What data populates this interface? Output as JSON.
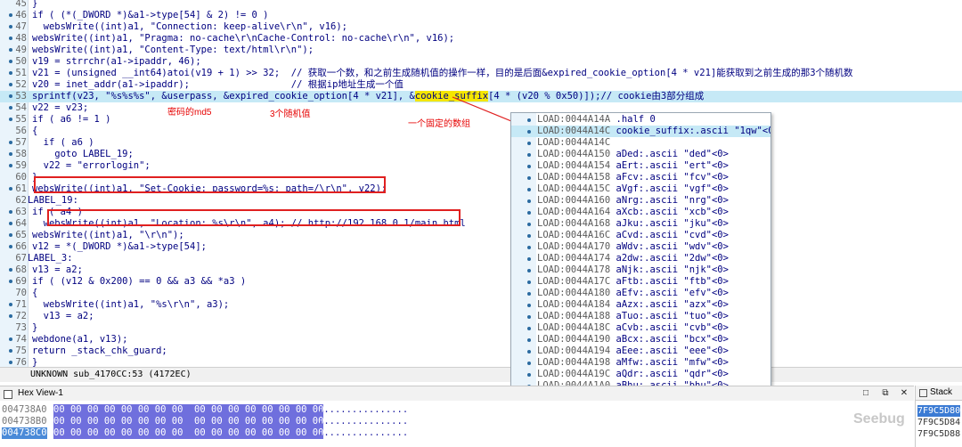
{
  "code_lines": [
    {
      "ln": "45",
      "text": "}",
      "dot": false
    },
    {
      "ln": "46",
      "text": "if ( (*(_DWORD *)&a1->type[54] & 2) != 0 )",
      "dot": true
    },
    {
      "ln": "47",
      "text": "  websWrite((int)a1, \"Connection: keep-alive\\r\\n\", v16);",
      "dot": true
    },
    {
      "ln": "48",
      "text": "websWrite((int)a1, \"Pragma: no-cache\\r\\nCache-Control: no-cache\\r\\n\", v16);",
      "dot": true
    },
    {
      "ln": "49",
      "text": "websWrite((int)a1, \"Content-Type: text/html\\r\\n\");",
      "dot": true
    },
    {
      "ln": "50",
      "text": "v19 = strrchr(a1->ipaddr, 46);",
      "dot": true
    },
    {
      "ln": "51",
      "text": "v21 = (unsigned __int64)atoi(v19 + 1) >> 32;  // 获取一个数，和之前生成随机值的操作一样，目的是后面&expired_cookie_option[4 * v21]能获取到之前生成的那3个随机数",
      "dot": true
    },
    {
      "ln": "52",
      "text": "v20 = inet_addr(a1->ipaddr);                  // 根据ip地址生成一个值",
      "dot": true
    },
    {
      "ln": "53",
      "text": "",
      "dot": true,
      "special": "sprintf"
    },
    {
      "ln": "54",
      "text": "v22 = v23;",
      "dot": true
    },
    {
      "ln": "55",
      "text": "if ( a6 != 1 )",
      "dot": true
    },
    {
      "ln": "56",
      "text": "{",
      "dot": false
    },
    {
      "ln": "57",
      "text": "  if ( a6 )",
      "dot": true
    },
    {
      "ln": "58",
      "text": "    goto LABEL_19;",
      "dot": true
    },
    {
      "ln": "59",
      "text": "  v22 = \"errorlogin\";",
      "dot": true
    },
    {
      "ln": "60",
      "text": "}",
      "dot": false
    },
    {
      "ln": "61",
      "text": "websWrite((int)a1, \"Set-Cookie: password=%s; path=/\\r\\n\", v22);",
      "dot": true
    },
    {
      "ln": "62",
      "text": "LABEL_19:",
      "dot": false,
      "label": true
    },
    {
      "ln": "63",
      "text": "if ( a4 )",
      "dot": true
    },
    {
      "ln": "64",
      "text": "  websWrite((int)a1, \"Location: %s\\r\\n\", a4); // http://192.168.0.1/main.html",
      "dot": true
    },
    {
      "ln": "65",
      "text": "websWrite((int)a1, \"\\r\\n\");",
      "dot": true
    },
    {
      "ln": "66",
      "text": "v12 = *(_DWORD *)&a1->type[54];",
      "dot": true
    },
    {
      "ln": "67",
      "text": "LABEL_3:",
      "dot": false,
      "label": true
    },
    {
      "ln": "68",
      "text": "v13 = a2;",
      "dot": true
    },
    {
      "ln": "69",
      "text": "if ( (v12 & 0x200) == 0 && a3 && *a3 )",
      "dot": true
    },
    {
      "ln": "70",
      "text": "{",
      "dot": false
    },
    {
      "ln": "71",
      "text": "  websWrite((int)a1, \"%s\\r\\n\", a3);",
      "dot": true
    },
    {
      "ln": "72",
      "text": "  v13 = a2;",
      "dot": true
    },
    {
      "ln": "73",
      "text": "}",
      "dot": false
    },
    {
      "ln": "74",
      "text": "webdone(a1, v13);",
      "dot": true
    },
    {
      "ln": "75",
      "text": "return _stack_chk_guard;",
      "dot": true
    },
    {
      "ln": "76",
      "text": "}",
      "dot": true
    }
  ],
  "sprintf_line": {
    "before": "sprintf(v23, \"%s%s%s\", &userpass, &expired_cookie_option[4 * v21], &",
    "highlight": "cookie_suffix",
    "after": "[4 * (v20 % 0x50)]);// cookie由3部分组成"
  },
  "annotations": {
    "md5": "密码的md5",
    "random3": "3个随机值",
    "fixed_array": "一个固定的数组"
  },
  "status_text": "UNKNOWN sub_4170CC:53 (4172EC)",
  "popup_lines": [
    {
      "addr": "LOAD:0044A14A",
      "text": ".half 0"
    },
    {
      "addr": "LOAD:0044A14C",
      "text": "cookie_suffix:.ascii \"1qw\"<0>",
      "selected": true
    },
    {
      "addr": "LOAD:0044A14C",
      "text": ""
    },
    {
      "addr": "LOAD:0044A150",
      "text": "aDed:.ascii \"ded\"<0>"
    },
    {
      "addr": "LOAD:0044A154",
      "text": "aErt:.ascii \"ert\"<0>"
    },
    {
      "addr": "LOAD:0044A158",
      "text": "aFcv:.ascii \"fcv\"<0>"
    },
    {
      "addr": "LOAD:0044A15C",
      "text": "aVgf:.ascii \"vgf\"<0>"
    },
    {
      "addr": "LOAD:0044A160",
      "text": "aNrg:.ascii \"nrg\"<0>"
    },
    {
      "addr": "LOAD:0044A164",
      "text": "aXcb:.ascii \"xcb\"<0>"
    },
    {
      "addr": "LOAD:0044A168",
      "text": "aJku:.ascii \"jku\"<0>"
    },
    {
      "addr": "LOAD:0044A16C",
      "text": "aCvd:.ascii \"cvd\"<0>"
    },
    {
      "addr": "LOAD:0044A170",
      "text": "aWdv:.ascii \"wdv\"<0>"
    },
    {
      "addr": "LOAD:0044A174",
      "text": "a2dw:.ascii \"2dw\"<0>"
    },
    {
      "addr": "LOAD:0044A178",
      "text": "aNjk:.ascii \"njk\"<0>"
    },
    {
      "addr": "LOAD:0044A17C",
      "text": "aFtb:.ascii \"ftb\"<0>"
    },
    {
      "addr": "LOAD:0044A180",
      "text": "aEfv:.ascii \"efv\"<0>"
    },
    {
      "addr": "LOAD:0044A184",
      "text": "aAzx:.ascii \"azx\"<0>"
    },
    {
      "addr": "LOAD:0044A188",
      "text": "aTuo:.ascii \"tuo\"<0>"
    },
    {
      "addr": "LOAD:0044A18C",
      "text": "aCvb:.ascii \"cvb\"<0>"
    },
    {
      "addr": "LOAD:0044A190",
      "text": "aBcx:.ascii \"bcx\"<0>"
    },
    {
      "addr": "LOAD:0044A194",
      "text": "aEee:.ascii \"eee\"<0>"
    },
    {
      "addr": "LOAD:0044A198",
      "text": "aMfw:.ascii \"mfw\"<0>"
    },
    {
      "addr": "LOAD:0044A19C",
      "text": "aQdr:.ascii \"qdr\"<0>"
    },
    {
      "addr": "LOAD:0044A1A0",
      "text": "aBhu:.ascii \"bhu\"<0>"
    }
  ],
  "hex_view": {
    "title": "Hex View-1",
    "rows": [
      {
        "addr": "004738A0",
        "bytes": "00 00 00 00 00 00 00 00  00 00 00 00 00 00 00 00",
        "ascii": "................"
      },
      {
        "addr": "004738B0",
        "bytes": "00 00 00 00 00 00 00 00  00 00 00 00 00 00 00 00",
        "ascii": "................"
      },
      {
        "addr": "004738C0",
        "bytes": "00 00 00 00 00 00 00 00  00 00 00 00 00 00 00 00",
        "ascii": "................",
        "current": true
      }
    ],
    "buttons": [
      "□",
      "⧉",
      "✕"
    ]
  },
  "stack": {
    "title": "Stack",
    "rows": [
      "7F9C5D80",
      "7F9C5D84",
      "7F9C5D88"
    ]
  },
  "watermark": "Seebug"
}
